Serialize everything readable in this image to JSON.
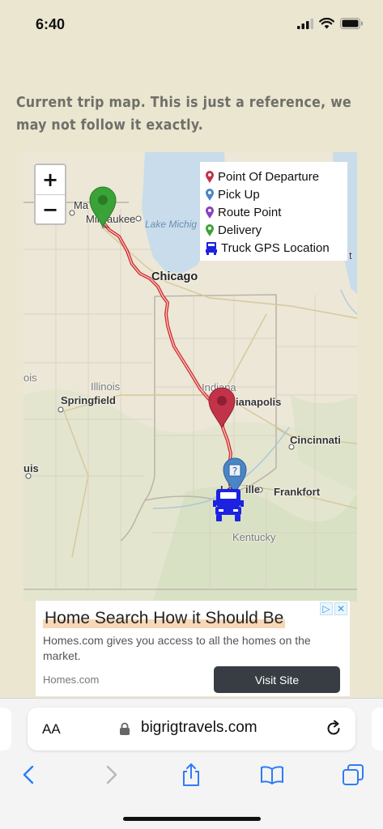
{
  "status": {
    "time": "6:40"
  },
  "caption": "Current trip map. This is just a reference, we may not follow it exactly.",
  "map": {
    "zoom_in": "+",
    "zoom_out": "−",
    "legend": [
      {
        "label": "Point Of Departure",
        "color": "#c2334a"
      },
      {
        "label": "Pick Up",
        "color": "#4a86c6"
      },
      {
        "label": "Route Point",
        "color": "#8a3fc1"
      },
      {
        "label": "Delivery",
        "color": "#3aa338"
      },
      {
        "label": "Truck GPS Location",
        "color": "#1c22e0"
      }
    ],
    "lake_label": "Lake Michig",
    "cities": {
      "madison": "Ma",
      "milwaukee": "Milwaukee",
      "chicago": "Chicago",
      "illinois": "Illinois",
      "springfield": "Springfield",
      "indiana": "Indiana",
      "indianapolis": "ianapolis",
      "cincinnati": "Cincinnati",
      "louisville_a": "Lo",
      "louisville_b": "ille",
      "frankfort": "Frankfort",
      "kentucky": "Kentucky",
      "left_edge_1": "ois",
      "left_edge_2": "uis",
      "right_edge": "t"
    },
    "route_color": "#d32f2f"
  },
  "ad": {
    "title": "Home Search How it Should Be",
    "description": "Homes.com gives you access to all the homes on the market.",
    "source": "Homes.com",
    "cta": "Visit Site"
  },
  "browser": {
    "aa": "AA",
    "url": "bigrigtravels.com"
  }
}
